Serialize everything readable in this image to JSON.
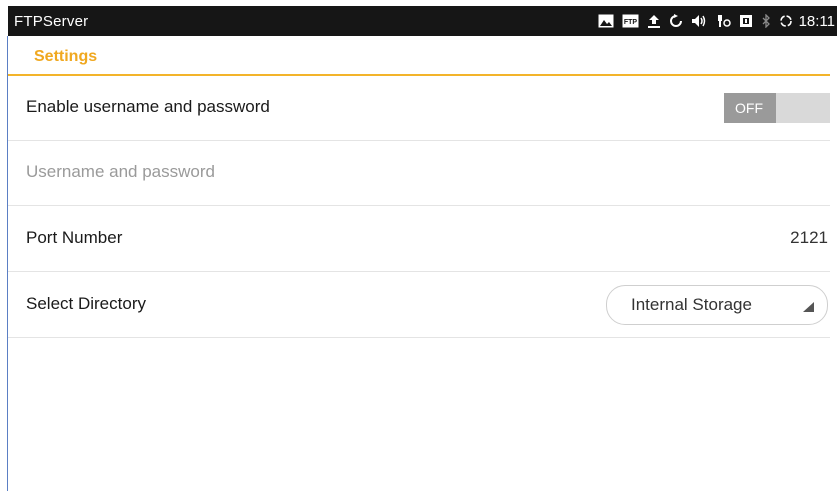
{
  "status_bar": {
    "app_name": "FTPServer",
    "time": "18:11",
    "icons": [
      "image-icon",
      "ftp-icon",
      "upload-icon",
      "sync-icon",
      "volume-icon",
      "usb-icon",
      "sim-icon",
      "bluetooth-icon",
      "loading-icon"
    ],
    "ftp_icon_text": "FTP"
  },
  "settings": {
    "header": "Settings",
    "accent_color": "#f3b42a",
    "rows": [
      {
        "label": "Enable username and password",
        "toggle": "OFF",
        "toggle_on": false
      },
      {
        "label": "Username and password",
        "disabled": true
      },
      {
        "label": "Port Number",
        "value": "2121"
      },
      {
        "label": "Select Directory",
        "dropdown_value": "Internal Storage"
      }
    ]
  }
}
